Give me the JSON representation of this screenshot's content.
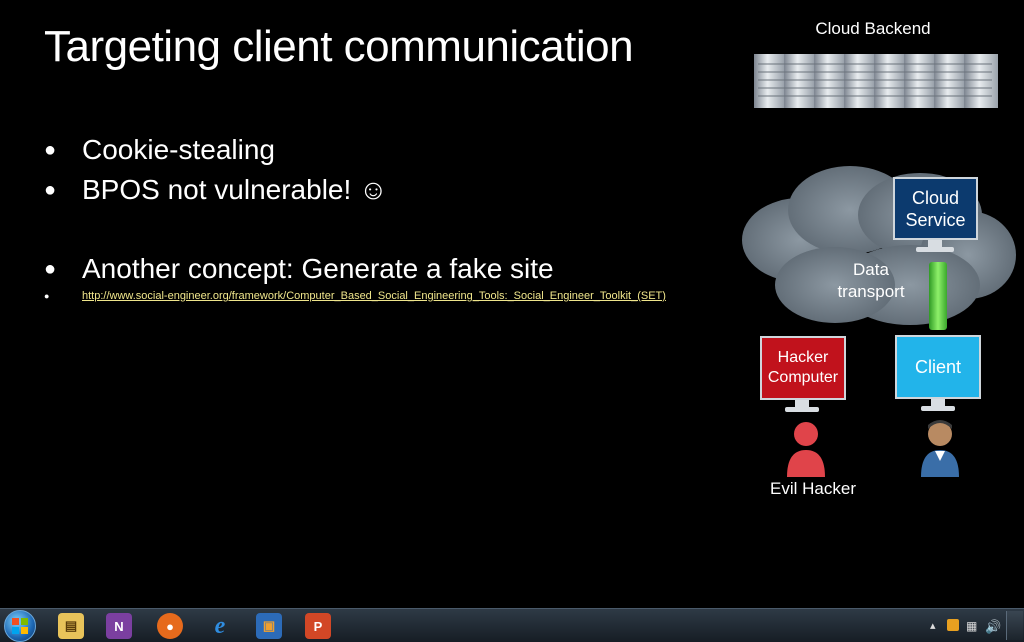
{
  "slide": {
    "title": "Targeting client communication",
    "bullets": [
      "Cookie-stealing",
      "BPOS not vulnerable! ☺",
      "Another concept: Generate a fake site"
    ],
    "link": "http://www.social-engineer.org/framework/Computer_Based_Social_Engineering_Tools:_Social_Engineer_Toolkit_(SET)"
  },
  "diagram": {
    "cloud_backend": "Cloud Backend",
    "cloud_service": "Cloud\nService",
    "data_transport": "Data\ntransport",
    "hacker_computer": "Hacker\nComputer",
    "client": "Client",
    "evil_hacker": "Evil Hacker"
  },
  "taskbar": {
    "apps": [
      {
        "name": "windows-explorer",
        "glyph": "▤"
      },
      {
        "name": "onenote",
        "glyph": "N"
      },
      {
        "name": "firefox",
        "glyph": "●"
      },
      {
        "name": "internet-explorer",
        "glyph": "e"
      },
      {
        "name": "virtualbox",
        "glyph": "▣"
      },
      {
        "name": "powerpoint",
        "glyph": "P"
      }
    ],
    "colors": {
      "explorer": "#e8c35a",
      "onenote": "#7b3fa0",
      "firefox": "#e66a1c",
      "ie": "#2f8de0",
      "virtualbox": "#2c6bb8",
      "powerpoint": "#d24726"
    }
  }
}
